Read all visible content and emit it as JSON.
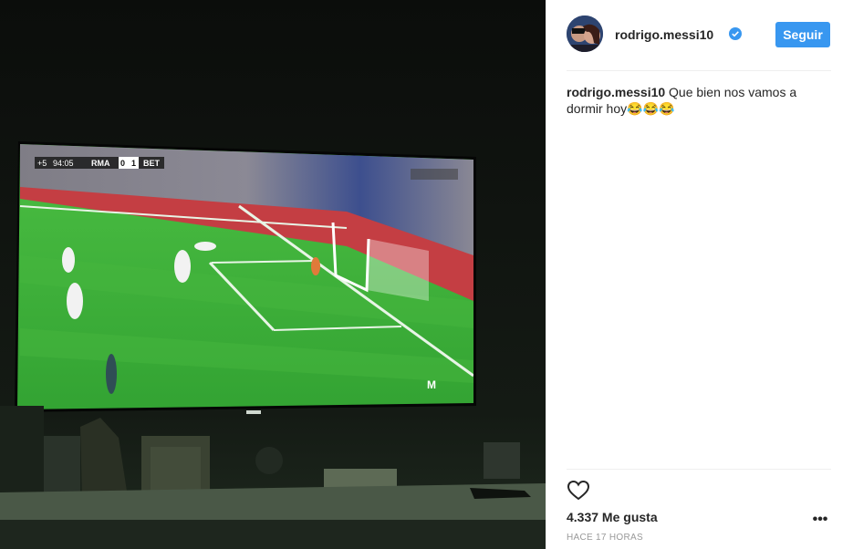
{
  "post": {
    "username": "rodrigo.messi10",
    "follow_label": "Seguir",
    "caption_user": "rodrigo.messi10",
    "caption_text": "Que bien nos vamos a dormir hoy😂😂😂",
    "likes": "4.337 Me gusta",
    "time": "HACE 17 HORAS",
    "more_label": "•••"
  },
  "scoreboard": {
    "added_time": "+5",
    "clock": "94:05",
    "home": "RMA",
    "home_score": "0",
    "away_score": "1",
    "away": "BET"
  },
  "icons": {
    "like": "heart-outline-icon",
    "verified": "verified-badge-icon",
    "more": "more-options-icon"
  },
  "colors": {
    "follow_button": "#3897f0",
    "text": "#262626",
    "muted": "#999999",
    "pitch": "#3fae3a"
  }
}
